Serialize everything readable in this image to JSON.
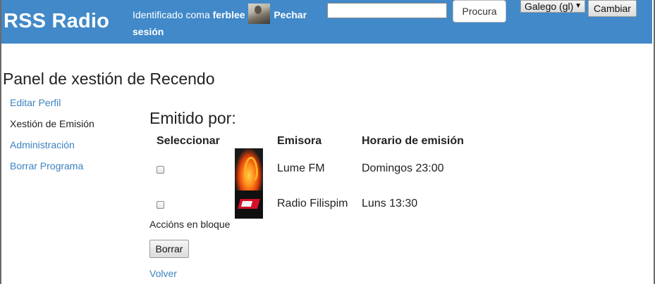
{
  "header": {
    "logo": "RSS Radio",
    "login_prefix": "Identificado coma",
    "username": "ferblee",
    "logout": "Pechar sesión",
    "search_placeholder": "",
    "search_button": "Procura",
    "language_selected": "Galego (gl)",
    "language_button": "Cambiar",
    "background_color": "#4189c9"
  },
  "page_title": "Panel de xestión de Recendo",
  "sidebar": {
    "items": [
      {
        "label": "Editar Perfil"
      },
      {
        "label": "Xestión de Emisión"
      },
      {
        "label": "Administración"
      },
      {
        "label": "Borrar Programa"
      }
    ]
  },
  "main": {
    "section_title": "Emitido por:",
    "columns": [
      "Seleccionar",
      "Emisora",
      "Horario de emisión"
    ],
    "rows": [
      {
        "station": "Lume FM",
        "schedule": "Domingos 23:00",
        "logo_icon": "flame-logo-icon"
      },
      {
        "station": "Radio Filispim",
        "schedule": "Luns 13:30",
        "logo_icon": "radio-filispim-logo-icon"
      }
    ],
    "bulk_actions_label": "Accións en bloque",
    "delete_button": "Borrar",
    "back_link": "Volver"
  },
  "colors": {
    "link": "#3b83c0",
    "header": "#4189c9"
  }
}
